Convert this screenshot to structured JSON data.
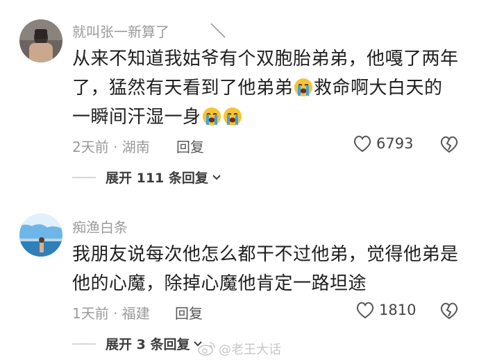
{
  "comments": [
    {
      "username": "就叫张一新算了",
      "text_segments": [
        "从来不知道我姑爷有个双胞胎弟弟，他嘎了两年了，猛然有天看到了他弟弟",
        "救命啊大白天的一瞬间汗湿一身"
      ],
      "emoji_icon": "crying-face-emoji",
      "meta": "2天前 · 湖南",
      "reply_label": "回复",
      "likes": "6793",
      "expand_label": "展开 111 条回复"
    },
    {
      "username": "痴渔白条",
      "text": "我朋友说每次他怎么都干不过他弟，觉得他弟是他的心魔，除掉心魔他肯定一路坦途",
      "meta": "1天前 · 福建",
      "reply_label": "回复",
      "likes": "1810",
      "expand_label": "展开 3 条回复"
    }
  ],
  "watermark": {
    "text": "@老王大话",
    "icon": "weibo-logo-icon"
  },
  "colors": {
    "text_primary": "#1e1e1e",
    "text_secondary": "#9a9a9a",
    "emoji_yellow": "#f7c431",
    "emoji_tear": "#3aa4e8"
  }
}
